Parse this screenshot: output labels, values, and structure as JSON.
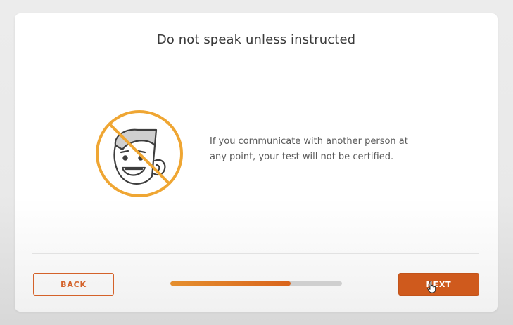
{
  "page": {
    "title": "Do not speak unless instructed",
    "message_lines": [
      "If you communicate with another person at",
      "any point, your test will not be certified."
    ]
  },
  "illustration": {
    "icon": "no-speaking-face-icon",
    "prohibition_color": "#efa633"
  },
  "footer": {
    "back_label": "BACK",
    "next_label": "NEXT",
    "progress_fraction": 0.7
  },
  "colors": {
    "accent": "#cf5a1d",
    "progress_fill": "#e58f2e",
    "progress_track": "#cfcfcf"
  }
}
